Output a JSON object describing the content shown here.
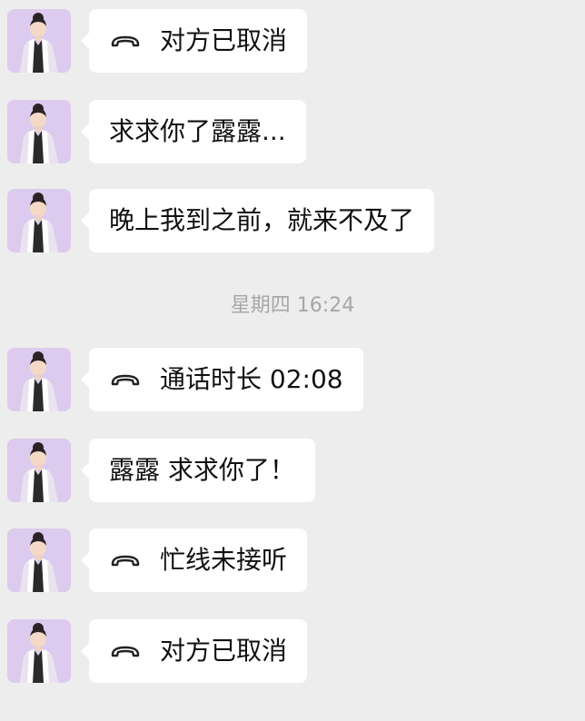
{
  "chat": {
    "messages": [
      {
        "type": "call",
        "icon": "phone-hangup-icon",
        "text": "对方已取消"
      },
      {
        "type": "text",
        "text": "求求你了露露..."
      },
      {
        "type": "text",
        "text": "晚上我到之前，就来不及了"
      },
      {
        "type": "call",
        "icon": "phone-hangup-icon",
        "text": "通话时长 02:08"
      },
      {
        "type": "text",
        "text": "露露 求求你了！"
      },
      {
        "type": "call",
        "icon": "phone-hangup-icon",
        "text": "忙线未接听"
      },
      {
        "type": "call",
        "icon": "phone-hangup-icon",
        "text": "对方已取消"
      }
    ],
    "time_divider": "星期四 16:24"
  },
  "colors": {
    "background": "#ededed",
    "bubble": "#ffffff",
    "text": "#111111",
    "timestamp": "#a7a7a7",
    "avatar_bg": "#d9c9ec"
  }
}
